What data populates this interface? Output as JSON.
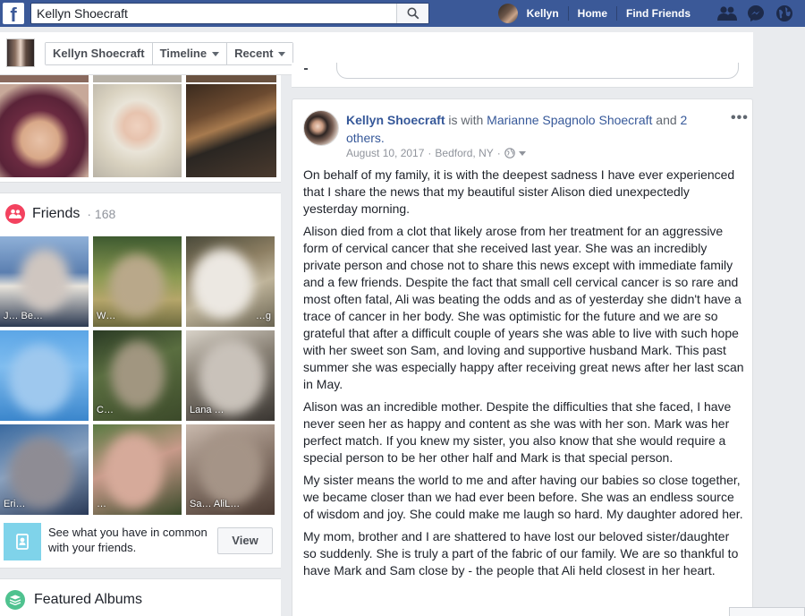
{
  "topbar": {
    "logo": "f",
    "search_value": "Kellyn Shoecraft",
    "user_name": "Kellyn",
    "home_label": "Home",
    "find_friends_label": "Find Friends",
    "icons": [
      "friend-requests-icon",
      "messenger-icon",
      "notifications-globe-icon"
    ]
  },
  "profile_nav": {
    "name_tab": "Kellyn Shoecraft",
    "timeline_tab": "Timeline",
    "recent_tab": "Recent"
  },
  "friends": {
    "title": "Friends",
    "count": "· 168",
    "tiles": [
      {
        "name": "J… Be…"
      },
      {
        "name": "W…"
      },
      {
        "name": "…g"
      },
      {
        "name": ""
      },
      {
        "name": "C…"
      },
      {
        "name": "Lana …"
      },
      {
        "name": "Eri…"
      },
      {
        "name": "…"
      },
      {
        "name": "Sa… AliL…"
      }
    ],
    "common_text": "See what you have in common with your friends.",
    "view_label": "View"
  },
  "albums": {
    "title": "Featured Albums"
  },
  "post": {
    "author": "Kellyn Shoecraft",
    "with_text": "is with",
    "tagged": "Marianne Spagnolo Shoecraft",
    "and_text": "and",
    "others": "2 others.",
    "date": "August 10, 2017",
    "location": "Bedford, NY",
    "more": "•••",
    "paragraphs": [
      "On behalf of my family, it is with the deepest sadness I have ever experienced that I share the news that my beautiful sister Alison died unexpectedly yesterday morning.",
      "Alison died from a clot that likely arose from her treatment for an aggressive form of cervical cancer that she received last year. She was an incredibly private person and chose not to share this news except with immediate family and a few friends. Despite the fact that small cell cervical cancer is so rare and most often fatal, Ali was beating the odds and as of yesterday she didn't have a trace of cancer in her body. She was optimistic for the future and we are so grateful that after a difficult couple of years she was able to live with such hope with her sweet son Sam, and loving and supportive husband Mark. This past summer she was especially happy after receiving great news after her last scan in May.",
      "Alison was an incredible mother. Despite the difficulties that she faced, I have never seen her as happy and content as she was with her son. Mark was her perfect match. If you knew my sister, you also know that she would require a special person to be her other half and Mark is that special person.",
      "My sister means the world to me and after having our babies so close together, we became closer than we had ever been before. She was an endless source of wisdom and joy. She could make me laugh so hard. My daughter adored her.",
      "My mom, brother and I are shattered to have lost our beloved sister/daughter so suddenly. She is truly a part of the fabric of our family. We are so thankful to have Mark and Sam close by - the people that Ali held closest in her heart."
    ]
  },
  "colors": {
    "brand_blue": "#3b5998",
    "link_blue": "#365899",
    "page_bg": "#e9ebee",
    "friends_red": "#f3425f",
    "albums_green": "#4fc28f"
  }
}
